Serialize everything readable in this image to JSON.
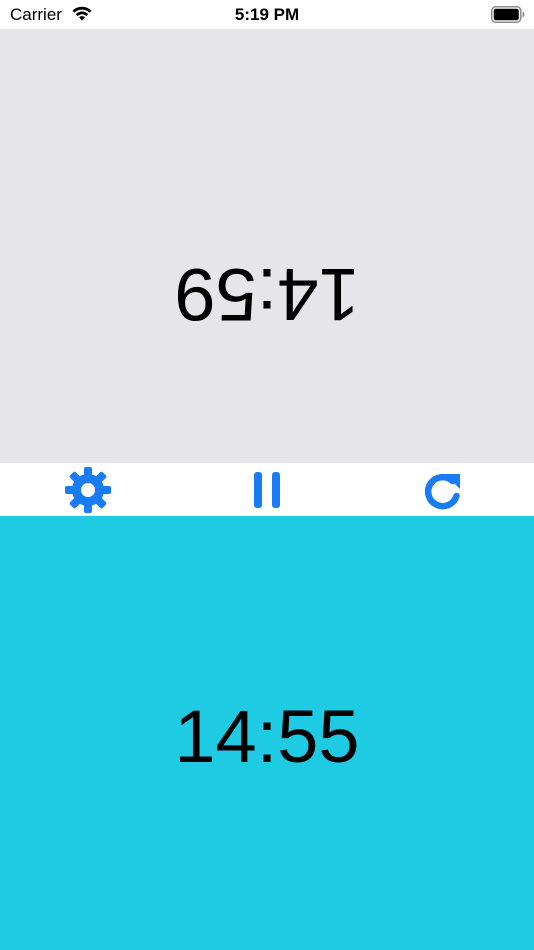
{
  "status_bar": {
    "carrier": "Carrier",
    "time": "5:19 PM",
    "wifi_icon": "wifi-icon",
    "battery_icon": "battery-full-icon"
  },
  "top_player": {
    "time": "14:59",
    "rotated": true,
    "background": "#e5e5ea"
  },
  "controls": {
    "settings_icon": "gear-icon",
    "pause_icon": "pause-icon",
    "reset_icon": "refresh-icon",
    "accent": "#1a7cf5"
  },
  "bottom_player": {
    "time": "14:55",
    "background": "#1fcbe3"
  }
}
